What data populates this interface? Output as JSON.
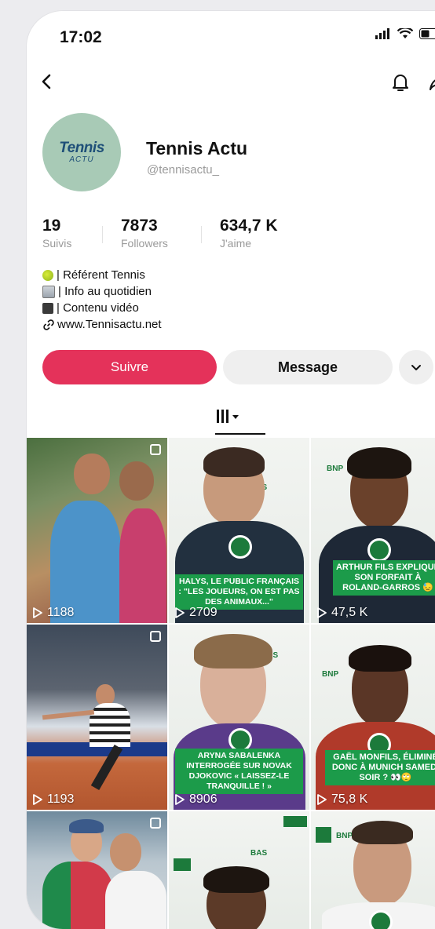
{
  "status_bar": {
    "time": "17:02",
    "icons": [
      "signal-icon",
      "wifi-icon",
      "battery-icon"
    ]
  },
  "topbar": {
    "icons": [
      "back-icon",
      "bell-icon",
      "share-icon"
    ]
  },
  "profile": {
    "logo": {
      "word1": "Tennis",
      "word2": "ACTU"
    },
    "name": "Tennis Actu",
    "handle": "@tennisactu_"
  },
  "stats": [
    {
      "value": "19",
      "label": "Suivis"
    },
    {
      "value": "7873",
      "label": "Followers"
    },
    {
      "value": "634,7 K",
      "label": "J'aime"
    }
  ],
  "bio": [
    {
      "icon": "tennis-ball-icon",
      "text": "| Référent Tennis"
    },
    {
      "icon": "newspaper-icon",
      "text": "| Info au quotidien"
    },
    {
      "icon": "video-camera-icon",
      "text": "| Contenu vidéo"
    },
    {
      "icon": "link-icon",
      "text": "www.Tennisactu.net"
    }
  ],
  "buttons": {
    "follow": "Suivre",
    "message": "Message"
  },
  "colors": {
    "accent": "#e4325a",
    "caption_green": "#1c9b4a",
    "avatar_bg": "#a8cab6"
  },
  "videos": [
    {
      "views": "1188",
      "caption": "",
      "multi": true
    },
    {
      "views": "2709",
      "caption": "HALYS, LE PUBLIC FRANÇAIS : \"LES JOUEURS, ON EST PAS DES ANIMAUX...\"",
      "multi": false
    },
    {
      "views": "47,5 K",
      "caption": "ARTHUR FILS EXPLIQUE SON FORFAIT À ROLAND-GARROS 😓",
      "multi": false
    },
    {
      "views": "1193",
      "caption": "",
      "multi": true
    },
    {
      "views": "8906",
      "caption": "ARYNA SABALENKA INTERROGÉE SUR NOVAK DJOKOVIC « LAISSEZ-LE TRANQUILLE ! »",
      "multi": false
    },
    {
      "views": "75,8 K",
      "caption": "GAËL MONFILS, ÉLIMINÉ DONC À MUNICH SAMEDI SOIR ? 👀🙄",
      "multi": false
    },
    {
      "views": "",
      "caption": "",
      "multi": true
    },
    {
      "views": "",
      "caption": "",
      "multi": false
    },
    {
      "views": "",
      "caption": "",
      "multi": false
    }
  ],
  "sponsor_texts": {
    "bnp": "BNP",
    "bas": "BAS"
  }
}
